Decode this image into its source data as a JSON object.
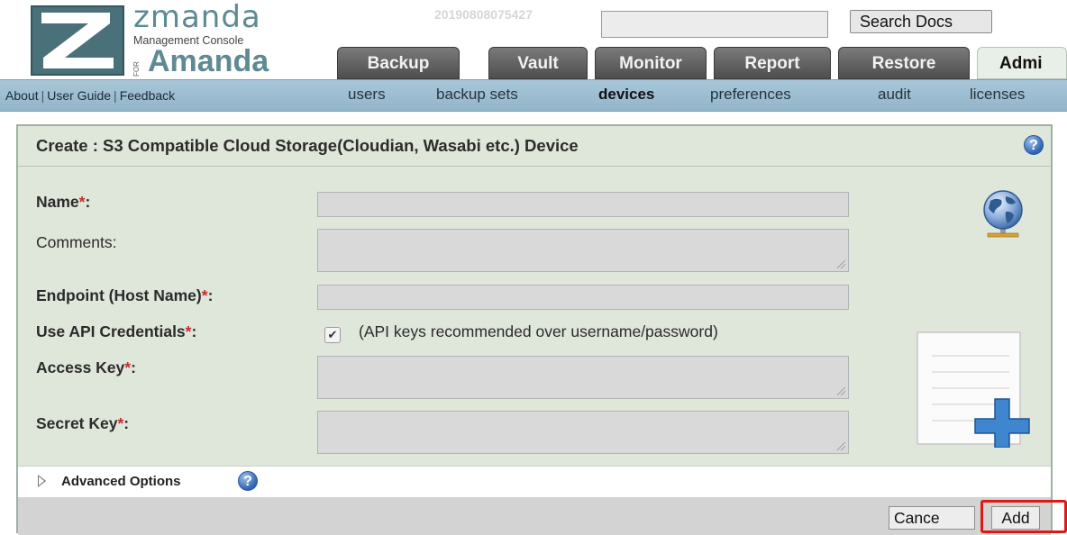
{
  "header": {
    "logo": {
      "name": "zmanda",
      "subtitle": "Management Console",
      "for": "FOR",
      "product": "Amanda"
    },
    "build_id": "20190808075427",
    "search": {
      "value": "",
      "placeholder": "",
      "button_label": "Search Docs"
    },
    "tabs": [
      {
        "label": "Backup",
        "active": false
      },
      {
        "label": "Vault",
        "active": false
      },
      {
        "label": "Monitor",
        "active": false
      },
      {
        "label": "Report",
        "active": false
      },
      {
        "label": "Restore",
        "active": false
      },
      {
        "label": "Admi",
        "active": true
      }
    ]
  },
  "subnav": {
    "util_links": [
      "About",
      "User Guide",
      "Feedback"
    ],
    "links": [
      {
        "label": "users",
        "active": false
      },
      {
        "label": "backup sets",
        "active": false
      },
      {
        "label": "devices",
        "active": true
      },
      {
        "label": "preferences",
        "active": false
      },
      {
        "label": "audit",
        "active": false
      },
      {
        "label": "licenses",
        "active": false
      }
    ]
  },
  "panel": {
    "title": "Create : S3 Compatible Cloud Storage(Cloudian, Wasabi etc.) Device",
    "help_glyph": "?",
    "fields": {
      "name": {
        "label": "Name",
        "required": "*",
        "suffix": ":",
        "value": ""
      },
      "comments": {
        "label": "Comments:",
        "value": ""
      },
      "endpoint": {
        "label": "Endpoint (Host Name)",
        "required": "*",
        "suffix": ":",
        "value": ""
      },
      "use_api": {
        "label": "Use API Credentials",
        "required": "*",
        "suffix": ":",
        "checked": true,
        "check_glyph": "✔",
        "note": "(API keys recommended over username/password)"
      },
      "access_key": {
        "label": "Access Key",
        "required": "*",
        "suffix": ":",
        "value": ""
      },
      "secret_key": {
        "label": "Secret Key",
        "required": "*",
        "suffix": ":",
        "value": ""
      }
    },
    "icons": [
      "globe-network-icon",
      "document-add-icon"
    ],
    "advanced": {
      "label": "Advanced Options",
      "expanded": false
    },
    "buttons": {
      "cancel": "Cance",
      "add": "Add"
    }
  },
  "colors": {
    "panel_bg": "#dfe6da",
    "subnav_bg": "#a8c6d8",
    "tab_bg": "#5e5e5e",
    "required": "#cc2a2a",
    "highlight": "#dd1a1a"
  }
}
